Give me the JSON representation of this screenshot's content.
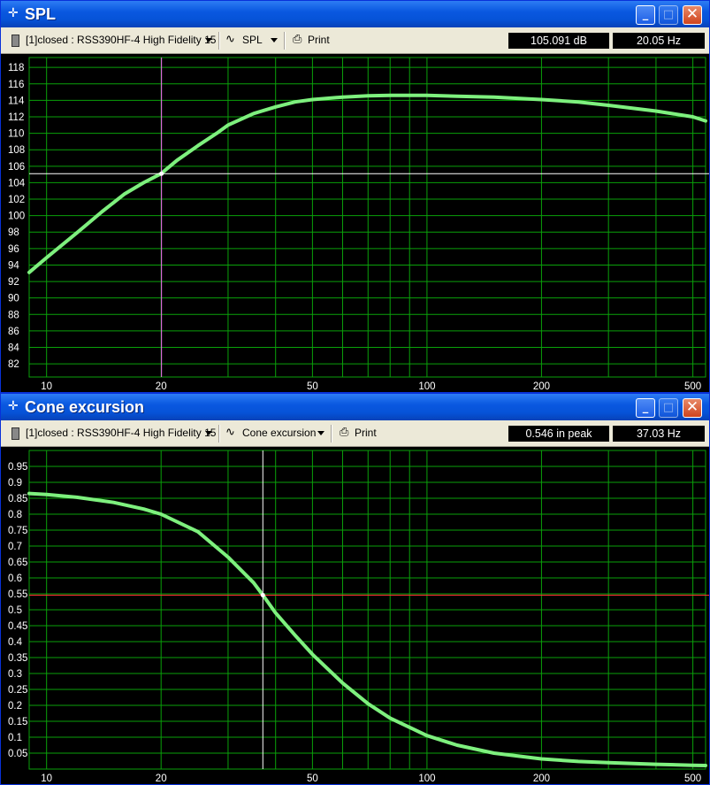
{
  "windows": [
    {
      "title": "SPL",
      "driver_select": "[1]closed : RSS390HF-4 High Fidelity 15",
      "plot_select": "SPL",
      "print_label": "Print",
      "readout_value": "105.091 dB",
      "readout_freq": "20.05 Hz",
      "colors": {
        "curve": "#7ef07e",
        "grid": "#0aa10a",
        "cursor_v": "#ff66ff",
        "cursor_h": "#ffffff"
      }
    },
    {
      "title": "Cone excursion",
      "driver_select": "[1]closed : RSS390HF-4 High Fidelity 15",
      "plot_select": "Cone excursion",
      "print_label": "Print",
      "readout_value": "0.546 in peak",
      "readout_freq": "37.03 Hz",
      "colors": {
        "curve": "#7ef07e",
        "grid": "#0aa10a",
        "cursor_v": "#ffffff",
        "cursor_h": "#ff3333"
      }
    }
  ],
  "chart_data": [
    {
      "type": "line",
      "title": "SPL",
      "xscale": "log",
      "xlim": [
        9,
        540
      ],
      "ylim": [
        80.4,
        119.2
      ],
      "x_tick_labels": [
        "10",
        "20",
        "50",
        "100",
        "200",
        "500"
      ],
      "y_tick_labels": [
        "82",
        "84",
        "86",
        "88",
        "90",
        "92",
        "94",
        "96",
        "98",
        "100",
        "102",
        "104",
        "106",
        "108",
        "110",
        "112",
        "114",
        "116",
        "118"
      ],
      "grid": true,
      "cursor": {
        "x": 20.05,
        "y": 105.091
      },
      "series": [
        {
          "x": [
            9,
            10,
            12,
            14,
            16,
            18,
            20,
            22,
            25,
            28,
            30,
            35,
            40,
            45,
            50,
            60,
            70,
            80,
            100,
            120,
            150,
            200,
            250,
            300,
            400,
            500,
            540
          ],
          "y": [
            93.1,
            94.9,
            97.9,
            100.5,
            102.6,
            104.0,
            105.1,
            106.7,
            108.5,
            110.0,
            111.0,
            112.4,
            113.2,
            113.8,
            114.1,
            114.4,
            114.55,
            114.6,
            114.6,
            114.5,
            114.4,
            114.1,
            113.8,
            113.4,
            112.7,
            112.0,
            111.5
          ]
        }
      ]
    },
    {
      "type": "line",
      "title": "Cone excursion",
      "xscale": "log",
      "xlim": [
        9,
        540
      ],
      "ylim": [
        0.0,
        1.0
      ],
      "x_tick_labels": [
        "10",
        "20",
        "50",
        "100",
        "200",
        "500"
      ],
      "y_tick_labels": [
        "0.05",
        "0.1",
        "0.15",
        "0.2",
        "0.25",
        "0.3",
        "0.35",
        "0.4",
        "0.45",
        "0.5",
        "0.55",
        "0.6",
        "0.65",
        "0.7",
        "0.75",
        "0.8",
        "0.85",
        "0.9",
        "0.95"
      ],
      "grid": true,
      "cursor": {
        "x": 37.03,
        "y": 0.546
      },
      "series": [
        {
          "x": [
            9,
            10,
            12,
            15,
            18,
            20,
            25,
            30,
            35,
            37.03,
            40,
            45,
            50,
            60,
            70,
            80,
            100,
            120,
            150,
            200,
            250,
            300,
            400,
            500,
            540
          ],
          "y": [
            0.865,
            0.862,
            0.853,
            0.837,
            0.816,
            0.8,
            0.745,
            0.665,
            0.585,
            0.546,
            0.49,
            0.42,
            0.36,
            0.27,
            0.205,
            0.16,
            0.105,
            0.075,
            0.05,
            0.032,
            0.024,
            0.02,
            0.015,
            0.012,
            0.011
          ]
        }
      ]
    }
  ]
}
